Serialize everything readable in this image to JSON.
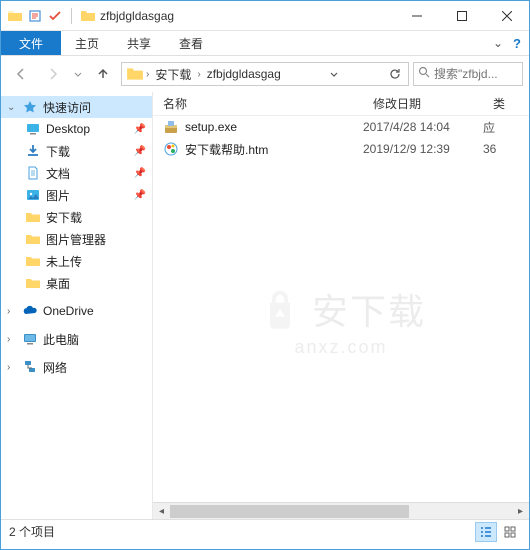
{
  "window": {
    "title": "zfbjdgldasgag"
  },
  "ribbon": {
    "file": "文件",
    "home": "主页",
    "share": "共享",
    "view": "查看"
  },
  "breadcrumb": {
    "items": [
      "安下载",
      "zfbjdgldasgag"
    ]
  },
  "search": {
    "placeholder": "搜索\"zfbjd..."
  },
  "sidebar": {
    "quick_access": "快速访问",
    "items": [
      {
        "label": "Desktop",
        "icon": "desktop",
        "pinned": true
      },
      {
        "label": "下载",
        "icon": "download",
        "pinned": true
      },
      {
        "label": "文档",
        "icon": "document",
        "pinned": true
      },
      {
        "label": "图片",
        "icon": "pictures",
        "pinned": true
      },
      {
        "label": "安下载",
        "icon": "folder",
        "pinned": false
      },
      {
        "label": "图片管理器",
        "icon": "folder",
        "pinned": false
      },
      {
        "label": "未上传",
        "icon": "folder",
        "pinned": false
      },
      {
        "label": "桌面",
        "icon": "folder",
        "pinned": false
      }
    ],
    "onedrive": "OneDrive",
    "this_pc": "此电脑",
    "network": "网络"
  },
  "columns": {
    "name": "名称",
    "date": "修改日期",
    "type": "类"
  },
  "files": [
    {
      "name": "setup.exe",
      "date": "2017/4/28 14:04",
      "type": "应",
      "icon": "installer"
    },
    {
      "name": "安下载帮助.htm",
      "date": "2019/12/9 12:39",
      "type": "36",
      "icon": "html"
    }
  ],
  "status": {
    "count": "2 个项目"
  },
  "watermark": {
    "text": "安下载",
    "sub": "anxz.com"
  }
}
